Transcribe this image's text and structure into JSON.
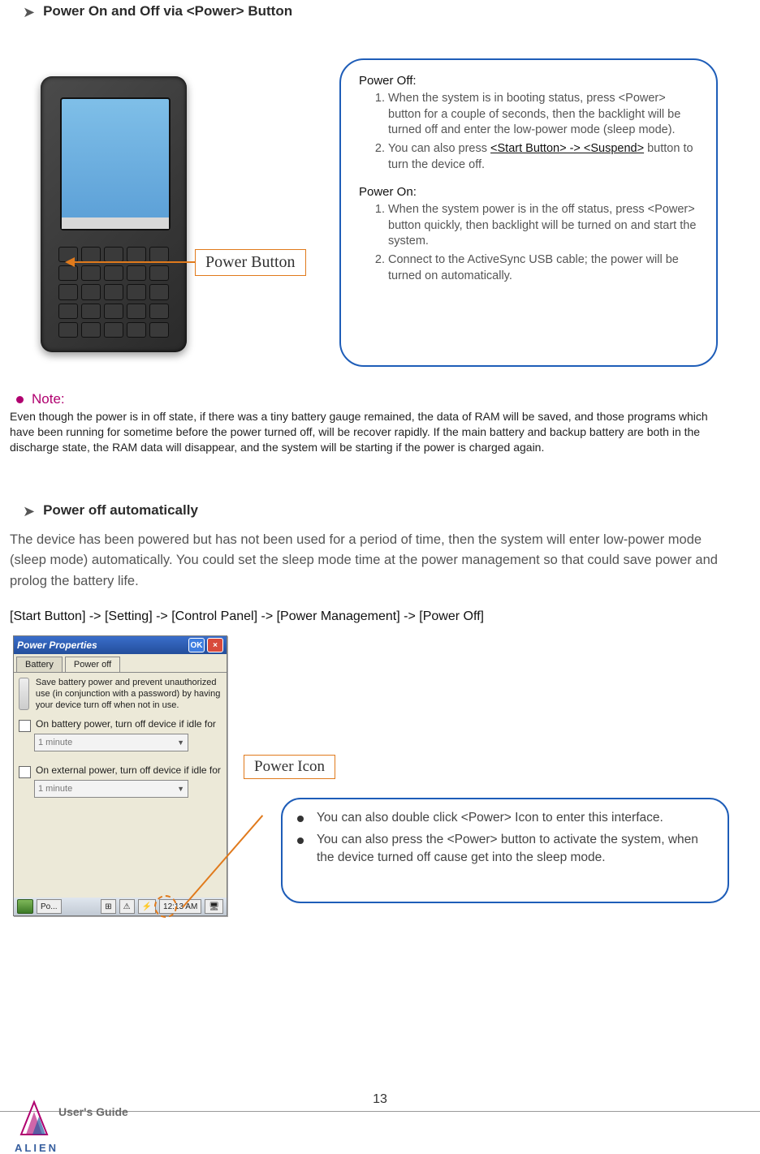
{
  "headings": {
    "h1": "Power On and Off via <Power> Button",
    "h2": "Power off automatically"
  },
  "labels": {
    "power_button": "Power Button",
    "power_icon": "Power Icon"
  },
  "roundbox": {
    "power_off_title": "Power Off:",
    "power_off_1": "When the system is in booting status, press <Power> button for a couple of seconds, then the backlight will be turned off and enter the low-power mode (sleep mode).",
    "power_off_2_a": "You can also press ",
    "power_off_2_b": "<Start Button> -> <Suspend>",
    "power_off_2_c": " button to turn the device off.",
    "power_on_title": "Power On:",
    "power_on_1": "When the system power is in the off status, press <Power> button quickly, then backlight will be turned on and start the system.",
    "power_on_2": "Connect to the ActiveSync USB cable; the power will be turned on automatically."
  },
  "note": {
    "title": "Note:",
    "body": "Even though the power is in off state, if there was a tiny battery gauge remained, the data of RAM will be saved, and those programs which have been running for sometime before the power turned off, will be recover rapidly. If the main battery and backup battery are both in the discharge state, the RAM data will disappear, and the system will be starting if the power is charged again."
  },
  "para": "The device has been powered but has not been used for a period of time, then the system will enter low-power mode (sleep mode) automatically. You could set the sleep mode time at the power management so that could save power and prolog the battery life.",
  "navpath": "[Start Button] -> [Setting] -> [Control Panel] -> [Power Management] -> [Power Off]",
  "window": {
    "title": "Power Properties",
    "ok": "OK",
    "close": "×",
    "tab_battery": "Battery",
    "tab_poweroff": "Power off",
    "desc": "Save battery power and prevent unauthorized use (in conjunction with a password) by having your device turn off when not in use.",
    "chk1": "On battery power, turn off device if idle for",
    "chk2": "On external power, turn off device if idle for",
    "sel1": "1 minute",
    "sel2": "1 minute",
    "task_po": "Po...",
    "task_time": "12:13 AM"
  },
  "rb2": {
    "b1": "You can also double click <Power> Icon to enter this interface.",
    "b2": "You can also press the <Power> button to activate the system, when the device turned off cause get into the sleep mode."
  },
  "footer": {
    "page": "13",
    "guide": "User's Guide",
    "brand": "ALIEN"
  }
}
